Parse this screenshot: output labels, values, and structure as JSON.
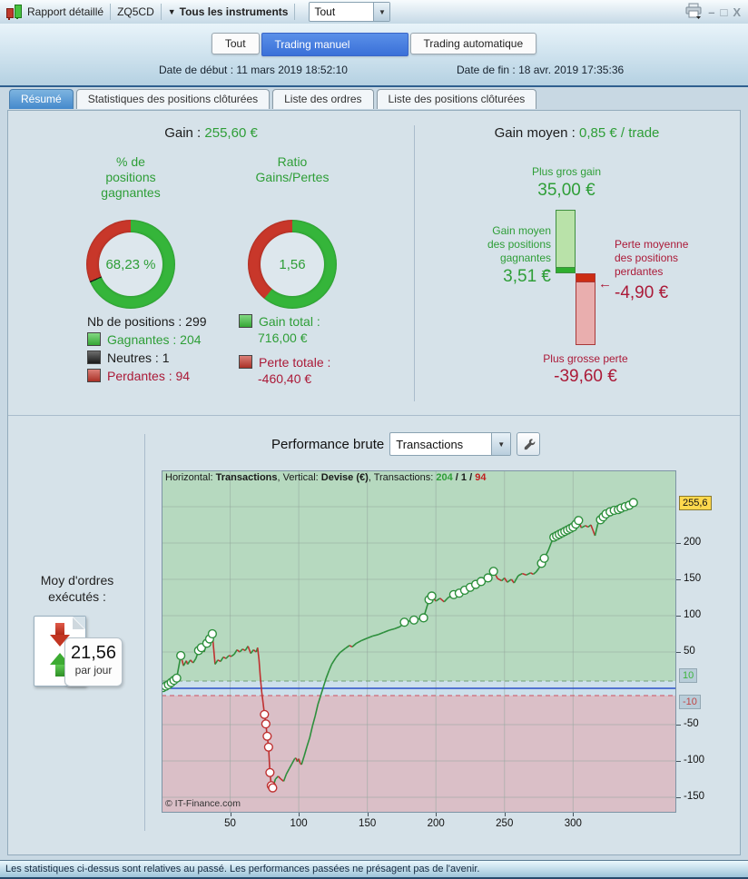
{
  "window": {
    "title": "Rapport détaillé",
    "code": "ZQ5CD",
    "instruments_label": "Tous les instruments",
    "filter_value": "Tout",
    "minimize": "–",
    "maximize": "□",
    "close": "X"
  },
  "mode_tabs": {
    "all": "Tout",
    "manual": "Trading manuel",
    "auto": "Trading automatique"
  },
  "dates": {
    "start_label": "Date de début :",
    "start_value": "11 mars 2019 18:52:10",
    "end_label": "Date de fin :",
    "end_value": "18 avr. 2019 17:35:36"
  },
  "tabs": {
    "resume": "Résumé",
    "stats": "Statistiques des positions clôturées",
    "orders": "Liste des ordres",
    "positions": "Liste des positions clôturées"
  },
  "summary": {
    "gain_label": "Gain :",
    "gain_value": "255,60 €",
    "nb_label": "Nb de positions : 299",
    "winners_label": "Gagnantes : 204",
    "neutral_label": "Neutres : 1",
    "losers_label": "Perdantes : 94",
    "gain_total_label": "Gain total :",
    "gain_total_value": "716,00 €",
    "loss_total_label": "Perte totale :",
    "loss_total_value": "-460,40 €",
    "colors": {
      "green_text": "#2e9e37",
      "red_text": "#ab1a38",
      "sq_green": "#3fc43f",
      "sq_black": "#1f1f1f",
      "sq_red": "#c83a2e"
    }
  },
  "gain_moyen": {
    "label": "Gain moyen :",
    "value": "0,85 € / trade"
  },
  "performance": {
    "title": "Performance brute",
    "select_value": "Transactions"
  },
  "avg_orders": {
    "line1": "Moy d'ordres",
    "line2": "exécutés :",
    "value": "21,56",
    "unit": "par jour"
  },
  "footer_text": "Les statistiques ci-dessus sont relatives au passé. Les performances passées ne présagent pas de l'avenir.",
  "chart_data": [
    {
      "type": "pie",
      "subtype": "donut",
      "title_lines": [
        "% de",
        "positions",
        "gagnantes"
      ],
      "value_label": "68,23 %",
      "segments": [
        {
          "label": "Gagnantes",
          "pct": 68.23,
          "color": "#35b53a"
        },
        {
          "label": "Neutres",
          "pct": 0.5,
          "color": "#1a1a1a"
        },
        {
          "label": "Perdantes",
          "pct": 31.27,
          "color": "#c8372a"
        }
      ]
    },
    {
      "type": "pie",
      "subtype": "donut",
      "title_lines": [
        "Ratio",
        "Gains/Pertes"
      ],
      "value_label": "1,56",
      "segments": [
        {
          "label": "Gains",
          "pct": 60.9,
          "color": "#35b53a"
        },
        {
          "label": "Pertes",
          "pct": 39.1,
          "color": "#c8372a"
        }
      ]
    },
    {
      "type": "bar",
      "title": "Gain moyen : 0,85 € / trade",
      "max_gain": 35.0,
      "avg_gain": 3.51,
      "avg_loss": -4.9,
      "max_loss": -39.6,
      "labels": {
        "max_gain": "Plus gros gain",
        "avg_gain_lines": [
          "Gain moyen",
          "des positions",
          "gagnantes"
        ],
        "avg_loss_lines": [
          "Perte moyenne",
          "des positions",
          "perdantes"
        ],
        "max_loss": "Plus grosse perte"
      },
      "values_text": {
        "max_gain": "35,00 €",
        "avg_gain": "3,51 €",
        "avg_loss": "-4,90 €",
        "max_loss": "-39,60 €"
      },
      "colors": {
        "gain_fill": "#b9e2a9",
        "gain_border": "#3f8f3f",
        "gain_avg": "#2fae2f",
        "loss_fill": "#e9aeae",
        "loss_border": "#a83838",
        "loss_avg": "#cc2d14"
      }
    },
    {
      "type": "line",
      "title": "Performance brute",
      "xlabel": "Transactions",
      "ylabel": "Devise (€)",
      "header": {
        "h_label": "Horizontal: ",
        "h_value": "Transactions",
        "v_label": ", Vertical: ",
        "v_value": "Devise (€)",
        "t_label": ", Transactions: ",
        "wins": "204",
        "sep1": " / ",
        "neutral": "1",
        "sep2": " / ",
        "losses": "94"
      },
      "x_ticks": [
        50,
        100,
        150,
        200,
        250,
        300
      ],
      "y_ticks": [
        200,
        150,
        100,
        50,
        -50,
        -100,
        -150
      ],
      "y_grid": [
        250,
        200,
        150,
        100,
        50,
        -50,
        -100,
        -150
      ],
      "xlim": [
        0,
        375
      ],
      "ylim": [
        -171,
        300
      ],
      "zones": {
        "upper": 10,
        "lower": -10,
        "pos_color": "#b6d9bf",
        "neutral_color": "#cde0eb",
        "neg_color": "#dabfc7"
      },
      "zero_line_color": "#2b50c8",
      "upper_dash_color": "#74a074",
      "lower_dash_color": "#cf4f5f",
      "line_up_color": "#2d8f3c",
      "line_down_color": "#bf3030",
      "grid_color": "#96a89e",
      "final_label": {
        "text": "255,6",
        "value": 255.6,
        "bg": "#ffd84d",
        "color": "#111"
      },
      "upper_label": {
        "text": "10",
        "value": 10,
        "bg": "#b9cdd9",
        "color": "#3db53d"
      },
      "lower_label": {
        "text": "-10",
        "value": -10,
        "bg": "#b9cdd9",
        "color": "#c04545"
      },
      "copyright": "© IT-Finance.com",
      "points": [
        [
          1,
          1,
          1
        ],
        [
          3,
          3,
          1
        ],
        [
          5,
          5,
          1
        ],
        [
          7,
          8,
          1
        ],
        [
          9,
          11,
          1
        ],
        [
          11,
          14,
          1
        ],
        [
          14,
          45,
          1
        ],
        [
          16,
          31,
          0
        ],
        [
          18,
          38,
          0
        ],
        [
          19,
          33,
          0
        ],
        [
          21,
          39,
          0
        ],
        [
          23,
          35,
          0
        ],
        [
          25,
          41,
          0
        ],
        [
          27,
          52,
          1
        ],
        [
          29,
          56,
          1
        ],
        [
          31,
          50,
          0
        ],
        [
          33,
          62,
          1
        ],
        [
          35,
          68,
          1
        ],
        [
          37,
          75,
          1
        ],
        [
          39,
          33,
          0
        ],
        [
          41,
          39,
          0
        ],
        [
          43,
          37,
          0
        ],
        [
          45,
          43,
          0
        ],
        [
          47,
          41,
          0
        ],
        [
          49,
          45,
          0
        ],
        [
          51,
          44,
          0
        ],
        [
          53,
          47,
          0
        ],
        [
          55,
          53,
          0
        ],
        [
          57,
          50,
          0
        ],
        [
          59,
          54,
          0
        ],
        [
          61,
          52,
          0
        ],
        [
          63,
          58,
          0
        ],
        [
          65,
          48,
          0
        ],
        [
          67,
          53,
          0
        ],
        [
          69,
          50,
          0
        ],
        [
          70,
          56,
          0
        ],
        [
          71,
          40,
          0
        ],
        [
          72,
          15,
          0
        ],
        [
          73,
          -5,
          0
        ],
        [
          74,
          -20,
          0
        ],
        [
          75,
          -36,
          1
        ],
        [
          76,
          -49,
          1
        ],
        [
          77,
          -66,
          1
        ],
        [
          78,
          -81,
          1
        ],
        [
          79,
          -116,
          1
        ],
        [
          80,
          -134,
          1
        ],
        [
          81,
          -137,
          1
        ],
        [
          83,
          -125,
          0
        ],
        [
          85,
          -121,
          0
        ],
        [
          87,
          -125,
          0
        ],
        [
          89,
          -128,
          0
        ],
        [
          91,
          -118,
          0
        ],
        [
          93,
          -111,
          0
        ],
        [
          95,
          -104,
          0
        ],
        [
          97,
          -97,
          0
        ],
        [
          98,
          -96,
          0
        ],
        [
          99,
          -101,
          0
        ],
        [
          100,
          -97,
          0
        ],
        [
          101,
          -103,
          0
        ],
        [
          102,
          -105,
          0
        ],
        [
          104,
          -93,
          0
        ],
        [
          106,
          -80,
          0
        ],
        [
          108,
          -68,
          0
        ],
        [
          110,
          -52,
          0
        ],
        [
          112,
          -38,
          0
        ],
        [
          114,
          -22,
          0
        ],
        [
          116,
          -10,
          0
        ],
        [
          118,
          2,
          0
        ],
        [
          120,
          14,
          0
        ],
        [
          122,
          24,
          0
        ],
        [
          124,
          33,
          0
        ],
        [
          127,
          42,
          0
        ],
        [
          130,
          49,
          0
        ],
        [
          134,
          55,
          0
        ],
        [
          137,
          59,
          0
        ],
        [
          139,
          57,
          0
        ],
        [
          142,
          62,
          0
        ],
        [
          146,
          66,
          0
        ],
        [
          150,
          69,
          0
        ],
        [
          154,
          72,
          0
        ],
        [
          158,
          74,
          0
        ],
        [
          162,
          77,
          0
        ],
        [
          166,
          80,
          0
        ],
        [
          170,
          82,
          0
        ],
        [
          174,
          85,
          0
        ],
        [
          177,
          91,
          1
        ],
        [
          184,
          94,
          1
        ],
        [
          191,
          97,
          1
        ],
        [
          195,
          122,
          1
        ],
        [
          197,
          127,
          1
        ],
        [
          200,
          120,
          0
        ],
        [
          203,
          124,
          0
        ],
        [
          206,
          119,
          0
        ],
        [
          209,
          125,
          0
        ],
        [
          213,
          129,
          1
        ],
        [
          217,
          131,
          1
        ],
        [
          221,
          135,
          1
        ],
        [
          225,
          139,
          1
        ],
        [
          229,
          143,
          1
        ],
        [
          233,
          147,
          1
        ],
        [
          238,
          152,
          1
        ],
        [
          242,
          161,
          1
        ],
        [
          245,
          151,
          0
        ],
        [
          248,
          148,
          0
        ],
        [
          250,
          152,
          0
        ],
        [
          252,
          146,
          0
        ],
        [
          255,
          150,
          0
        ],
        [
          257,
          145,
          0
        ],
        [
          260,
          155,
          0
        ],
        [
          263,
          158,
          0
        ],
        [
          266,
          156,
          0
        ],
        [
          269,
          159,
          0
        ],
        [
          271,
          157,
          0
        ],
        [
          273,
          160,
          0
        ],
        [
          275,
          165,
          0
        ],
        [
          277,
          172,
          1
        ],
        [
          279,
          179,
          1
        ],
        [
          282,
          190,
          0
        ],
        [
          284,
          200,
          0
        ],
        [
          286,
          208,
          1
        ],
        [
          288,
          210,
          1
        ],
        [
          290,
          212,
          1
        ],
        [
          292,
          214,
          1
        ],
        [
          294,
          216,
          1
        ],
        [
          296,
          218,
          1
        ],
        [
          298,
          220,
          1
        ],
        [
          300,
          222,
          1
        ],
        [
          302,
          226,
          1
        ],
        [
          304,
          231,
          1
        ],
        [
          306,
          221,
          0
        ],
        [
          309,
          224,
          0
        ],
        [
          311,
          222,
          0
        ],
        [
          313,
          225,
          0
        ],
        [
          316,
          210,
          0
        ],
        [
          318,
          226,
          0
        ],
        [
          320,
          232,
          1
        ],
        [
          322,
          236,
          1
        ],
        [
          324,
          240,
          1
        ],
        [
          327,
          243,
          1
        ],
        [
          330,
          245,
          1
        ],
        [
          333,
          246,
          1
        ],
        [
          335,
          248,
          1
        ],
        [
          338,
          250,
          1
        ],
        [
          341,
          252,
          1
        ],
        [
          344,
          255.6,
          1
        ]
      ]
    }
  ]
}
